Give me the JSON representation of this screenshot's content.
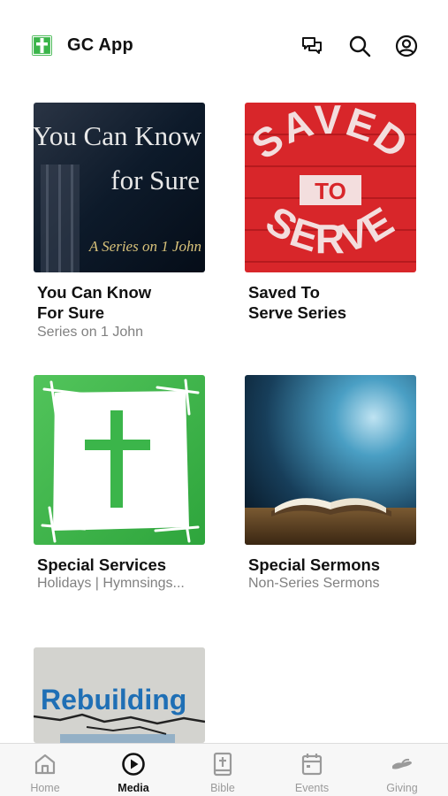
{
  "header": {
    "app_title": "GC App",
    "icons": [
      "logo-cross-icon",
      "chat-icon",
      "search-icon",
      "account-icon"
    ],
    "logo_color": "#3bb54a"
  },
  "media": {
    "items": [
      {
        "title_line1": "You Can Know",
        "title_line2": "For Sure",
        "subtitle": "Series on 1 John",
        "art": {
          "line1": "You Can Know",
          "line2": "for Sure",
          "tagline": "A Series on 1 John",
          "bg_color": "#0b1a2b",
          "tagline_color": "#d8c27a"
        }
      },
      {
        "title_line1": "Saved To",
        "title_line2": "Serve Series",
        "subtitle": "",
        "art": {
          "word_top": "SAVED",
          "word_middle": "TO",
          "word_bottom": "SERVE",
          "bg_color": "#d8262a"
        }
      },
      {
        "title_line1": "Special Services",
        "title_line2": "",
        "subtitle": "Holidays | Hymnsings...",
        "art": {
          "bg_color": "#3bb54a"
        }
      },
      {
        "title_line1": "Special Sermons",
        "title_line2": "",
        "subtitle": "Non-Series Sermons",
        "art": {
          "bg_color": "#1e4d6b"
        }
      },
      {
        "title_line1": "",
        "title_line2": "",
        "subtitle": "",
        "art": {
          "word": "Rebuilding",
          "word_color": "#1f6fb5",
          "bg_color": "#d9d9d6"
        }
      }
    ]
  },
  "tabbar": {
    "tabs": [
      {
        "label": "Home",
        "icon": "home-icon",
        "active": false
      },
      {
        "label": "Media",
        "icon": "play-circle-icon",
        "active": true
      },
      {
        "label": "Bible",
        "icon": "bible-icon",
        "active": false
      },
      {
        "label": "Events",
        "icon": "calendar-icon",
        "active": false
      },
      {
        "label": "Giving",
        "icon": "giving-hand-icon",
        "active": false
      }
    ]
  }
}
